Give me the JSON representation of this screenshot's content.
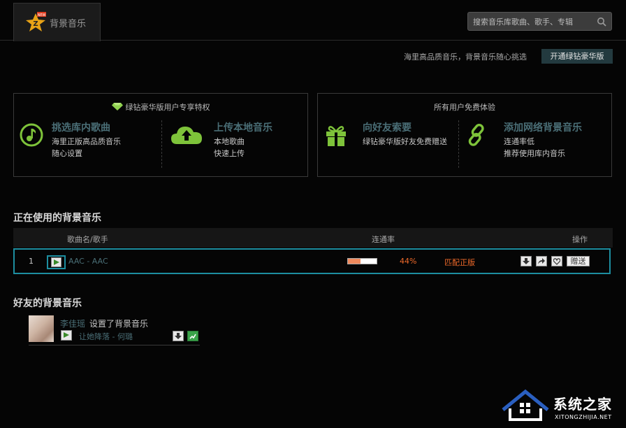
{
  "tab": {
    "label": "背景音乐",
    "badge": "NEW"
  },
  "search": {
    "placeholder": "搜索音乐库歌曲、歌手、专辑"
  },
  "promo": {
    "text": "海里高品质音乐，背景音乐随心挑选",
    "button": "开通绿钻豪华版"
  },
  "vip_box": {
    "title": "绿钻豪华版用户专享特权",
    "features": [
      {
        "icon": "music-note-icon",
        "title": "挑选库内歌曲",
        "lines": [
          "海里正版高品质音乐",
          "随心设置"
        ]
      },
      {
        "icon": "cloud-upload-icon",
        "title": "上传本地音乐",
        "lines": [
          "本地歌曲",
          "快速上传"
        ]
      }
    ]
  },
  "free_box": {
    "title": "所有用户免费体验",
    "features": [
      {
        "icon": "gift-icon",
        "title": "向好友索要",
        "lines": [
          "绿钻豪华版好友免费赠送"
        ]
      },
      {
        "icon": "link-icon",
        "title": "添加网络背景音乐",
        "lines": [
          "连通率低",
          "推荐使用库内音乐"
        ]
      }
    ]
  },
  "current": {
    "section_title": "正在使用的背景音乐",
    "headers": {
      "song": "歌曲名/歌手",
      "rate": "连通率",
      "actions": "操作"
    },
    "rows": [
      {
        "index": "1",
        "song": "AAC - AAC",
        "rate_text": "44%",
        "rate": 0.44,
        "status": "匹配正版",
        "gift": "赠送"
      }
    ]
  },
  "friends": {
    "section_title": "好友的背景音乐",
    "items": [
      {
        "name": "李佳瑶",
        "action": "设置了背景音乐",
        "song": "让她降落 - 何璐"
      }
    ]
  },
  "watermark": {
    "text": "系统之家",
    "url": "XITONGZHIJIA.NET"
  },
  "colors": {
    "accent_teal": "#1d8ea0",
    "link": "#4a6e76",
    "green": "#7ec33a",
    "orange": "#f06a2a"
  }
}
